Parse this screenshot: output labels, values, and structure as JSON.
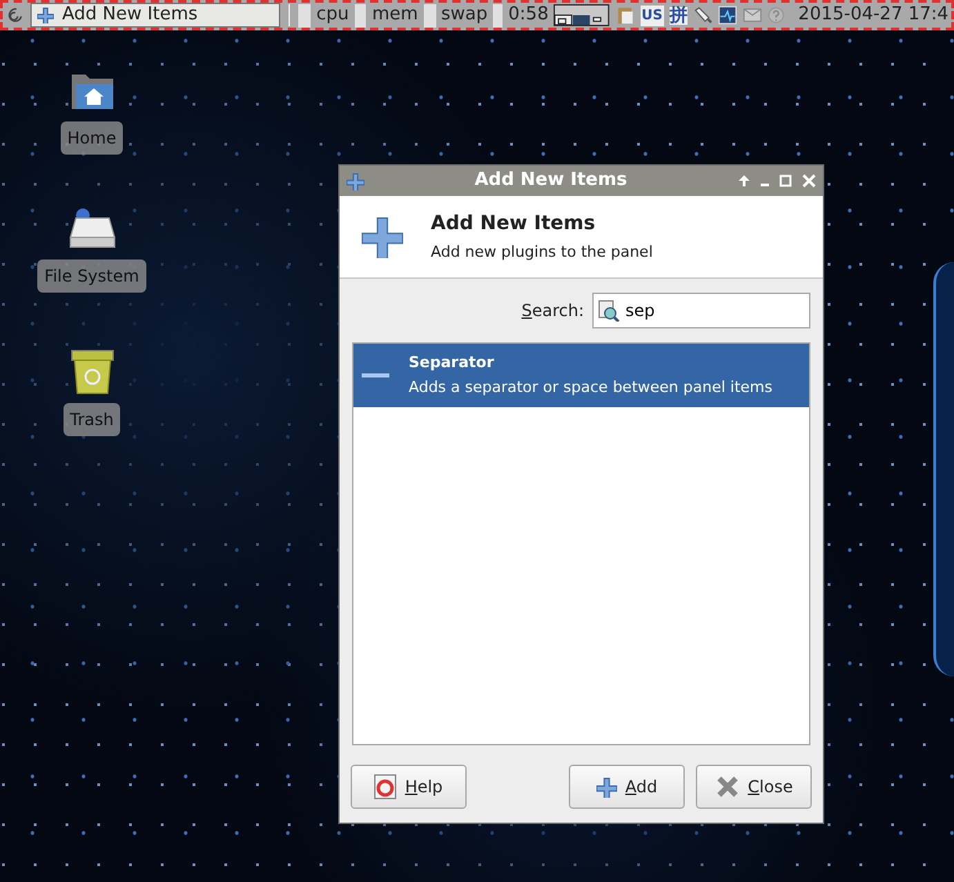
{
  "panel": {
    "task": {
      "label": "Add New Items",
      "selected": true
    },
    "monitors": [
      "cpu",
      "mem",
      "swap"
    ],
    "uptime": "0:58",
    "keyboard_layout": "US",
    "input_method": "拼",
    "clock": "2015-04-27 17:4"
  },
  "desktop_icons": [
    {
      "kind": "home",
      "label": "Home"
    },
    {
      "kind": "drive",
      "label": "File System"
    },
    {
      "kind": "trash",
      "label": "Trash"
    }
  ],
  "dialog": {
    "title": "Add New Items",
    "heading": "Add New Items",
    "subheading": "Add new plugins to the panel",
    "search": {
      "label": "Search:",
      "value": "sep"
    },
    "items": [
      {
        "name": "Separator",
        "description": "Adds a separator or space between panel items",
        "selected": true
      }
    ],
    "buttons": [
      {
        "kind": "help",
        "label": "Help"
      },
      {
        "kind": "add",
        "label": "Add"
      },
      {
        "kind": "close",
        "label": "Close"
      }
    ]
  }
}
